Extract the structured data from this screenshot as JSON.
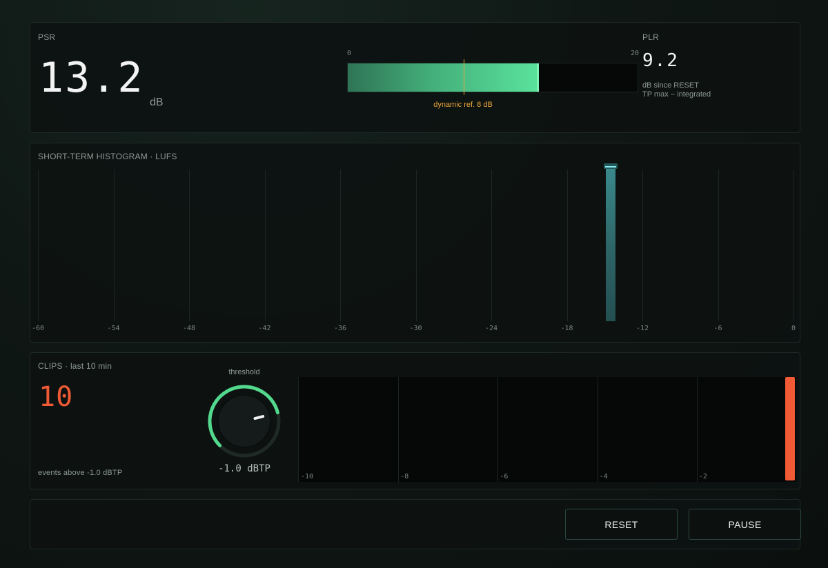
{
  "psr": {
    "label": "PSR",
    "value": "13.2",
    "unit": "dB",
    "meter": {
      "min_label": "0",
      "max_label": "20",
      "min": 0,
      "max": 20,
      "value": 13.2,
      "ref_value": 8,
      "ref_label": "dynamic ref. 8 dB",
      "fill_color": "#5ae39c",
      "ref_color": "#e8a43a"
    }
  },
  "plr": {
    "label": "PLR",
    "value": "9.2",
    "note1": "dB since RESET",
    "note2": "TP max − integrated"
  },
  "histogram": {
    "title": "SHORT-TERM HISTOGRAM · LUFS",
    "ticks": [
      "-60",
      "-54",
      "-48",
      "-42",
      "-36",
      "-30",
      "-24",
      "-18",
      "-12",
      "-6",
      "0"
    ],
    "peak_lufs": -14.5,
    "bar_color": "#3a8a8c"
  },
  "clips": {
    "title": "CLIPS · last 10 min",
    "count": "10",
    "caption": "events above -1.0 dBTP",
    "count_color": "#f05a34",
    "knob": {
      "label": "threshold",
      "value_label": "-1.0 dBTP",
      "value": -1.0,
      "accent": "#52d98e"
    },
    "ticks": [
      "-10",
      "-8",
      "-6",
      "-4",
      "-2"
    ]
  },
  "controls": {
    "reset_label": "RESET",
    "pause_label": "PAUSE"
  }
}
